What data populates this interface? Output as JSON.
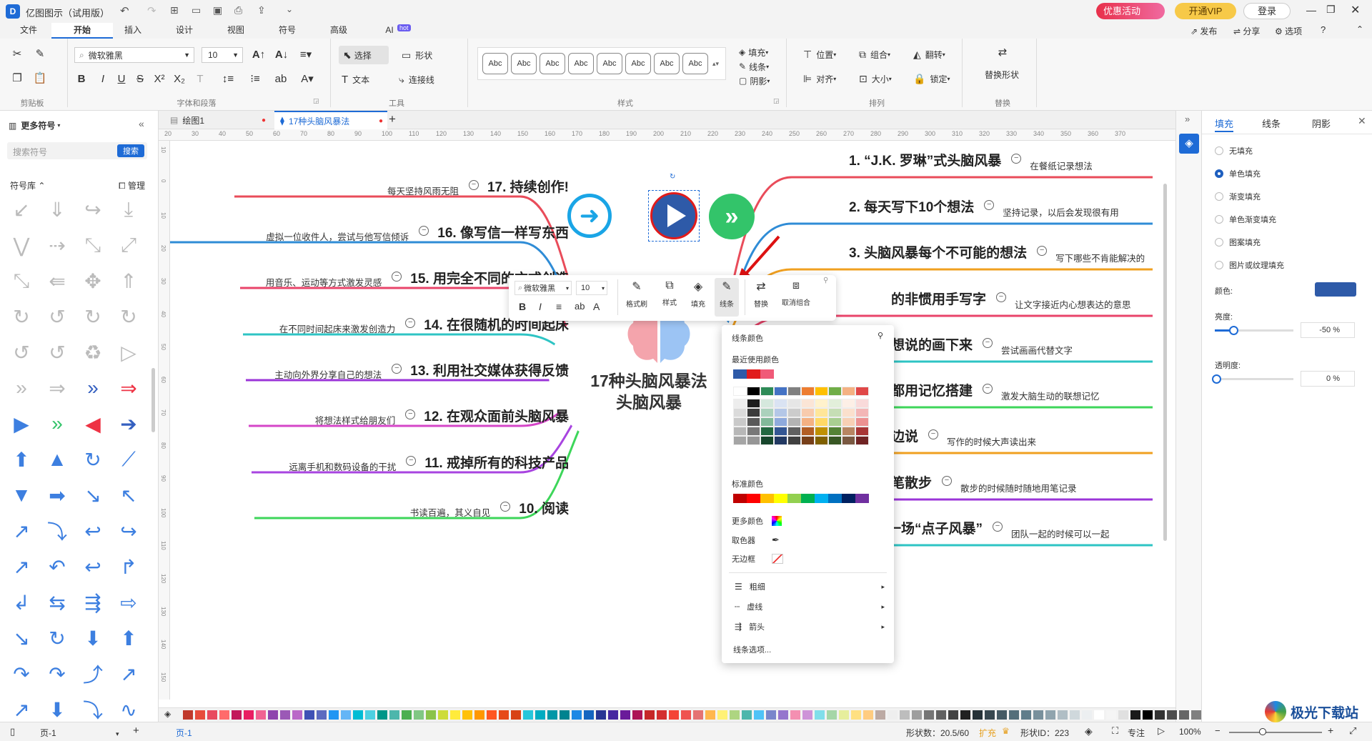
{
  "app": {
    "title": "亿图图示（试用版）",
    "promo": "优惠活动",
    "vip": "开通VIP",
    "login": "登录"
  },
  "menu": {
    "tabs": [
      "文件",
      "开始",
      "插入",
      "设计",
      "视图",
      "符号",
      "高级",
      "AI"
    ],
    "ai_badge": "hot",
    "active": "开始",
    "right": [
      "发布",
      "分享",
      "选项"
    ]
  },
  "ribbon": {
    "font_name": "微软雅黑",
    "font_size": "10",
    "select": "选择",
    "shape": "形状",
    "text": "文本",
    "connector": "连接线",
    "style_sample": "Abc",
    "fill": "填充",
    "line": "线条",
    "shadow": "阴影",
    "position": "位置",
    "group": "组合",
    "flip": "翻转",
    "align": "对齐",
    "size": "大小",
    "lock": "锁定",
    "replace_shape": "替换形状",
    "groups": [
      "剪贴板",
      "字体和段落",
      "工具",
      "样式",
      "排列",
      "替换"
    ]
  },
  "left_panel": {
    "title": "更多符号",
    "search_placeholder": "搜索符号",
    "search_btn": "搜索",
    "lib": "符号库",
    "manage": "管理"
  },
  "doc_tabs": [
    {
      "label": "绘图1"
    },
    {
      "label": "17种头脑风暴法"
    }
  ],
  "ruler_ticks": [
    "20",
    "30",
    "40",
    "50",
    "60",
    "70",
    "80",
    "90",
    "100",
    "110",
    "120",
    "130",
    "140",
    "150",
    "160",
    "170",
    "180",
    "190",
    "200",
    "210",
    "220",
    "230",
    "240",
    "250",
    "260",
    "270",
    "280",
    "290",
    "300",
    "310",
    "320",
    "330",
    "340",
    "350",
    "360",
    "370"
  ],
  "vruler_ticks": [
    "10",
    "0",
    "10",
    "20",
    "30",
    "40",
    "50",
    "60",
    "70",
    "80",
    "90",
    "100",
    "110",
    "120",
    "130",
    "140",
    "150"
  ],
  "mindmap": {
    "center": "17种头脑风暴法\n头脑风暴",
    "left": [
      {
        "title": "17. 持续创作!",
        "note": "每天坚持风雨无阻",
        "color": "#e94c5a"
      },
      {
        "title": "16. 像写信一样写东西",
        "note": "虚拟一位收件人，尝试与他写信倾诉",
        "color": "#2f8cd6"
      },
      {
        "title": "15. 用完全不同的方式创造",
        "note": "用音乐、运动等方式激发灵感",
        "color": "#e9446a"
      },
      {
        "title": "14. 在很随机的时间起床",
        "note": "在不同时间起床来激发创造力",
        "color": "#2ec4c4"
      },
      {
        "title": "13. 利用社交媒体获得反馈",
        "note": "主动向外界分享自己的想法",
        "color": "#9b35d8"
      },
      {
        "title": "12. 在观众面前头脑风暴",
        "note": "将想法样式给朋友们",
        "color": "#d546c8"
      },
      {
        "title": "11. 戒掉所有的科技产品",
        "note": "远离手机和数码设备的干扰",
        "color": "#a844e0"
      },
      {
        "title": "10. 阅读",
        "note": "书读百遍，其义自见",
        "color": "#3dd65a"
      }
    ],
    "right": [
      {
        "title": "1. “J.K. 罗琳”式头脑风暴",
        "note": "在餐纸记录想法",
        "color": "#e94c5a"
      },
      {
        "title": "2. 每天写下10个想法",
        "note": "坚持记录，以后会发现很有用",
        "color": "#2f8cd6"
      },
      {
        "title": "3. 头脑风暴每个不可能的想法",
        "note": "写下哪些不肯能解决的",
        "color": "#f0a020"
      },
      {
        "title": "的非惯用手写字",
        "note": "让文字接近内心想表达的意思",
        "color": "#e9446a"
      },
      {
        "title": "想说的画下来",
        "note": "尝试画画代替文字",
        "color": "#2ec4c4"
      },
      {
        "title": "都用记忆搭建",
        "note": "激发大脑生动的联想记忆",
        "color": "#3dd65a"
      },
      {
        "title": "边说",
        "note": "写作的时候大声读出来",
        "color": "#f0a020"
      },
      {
        "title": "笔散步",
        "note": "散步的时候随时随地用笔记录",
        "color": "#9b35d8"
      },
      {
        "title": "一场“点子风暴”",
        "note": "团队一起的时候可以一起",
        "color": "#2ec4c4"
      }
    ]
  },
  "float_toolbar": {
    "font": "微软雅黑",
    "size": "10",
    "buttons": [
      "格式刷",
      "样式",
      "填充",
      "线条",
      "替换",
      "取消组合"
    ]
  },
  "line_color_menu": {
    "title": "线条颜色",
    "recent": "最近使用颜色",
    "standard": "标准颜色",
    "more": "更多颜色",
    "picker": "取色器",
    "none": "无边框",
    "items": [
      "粗细",
      "虚线",
      "箭头"
    ],
    "options": "线条选项...",
    "recent_colors": [
      "#2e5aa8",
      "#e11b1b",
      "#f05a78"
    ],
    "standard_colors": [
      "#c00000",
      "#ff0000",
      "#ffc000",
      "#ffff00",
      "#92d050",
      "#00b050",
      "#00b0f0",
      "#0070c0",
      "#002060",
      "#7030a0"
    ]
  },
  "right_panel": {
    "tabs": [
      "填充",
      "线条",
      "阴影"
    ],
    "fill_options": [
      "无填充",
      "单色填充",
      "渐变填充",
      "单色渐变填充",
      "图案填充",
      "图片或纹理填充"
    ],
    "selected": "单色填充",
    "color_label": "颜色:",
    "color": "#2e5aa8",
    "brightness_label": "亮度:",
    "brightness": "-50 %",
    "transparency_label": "透明度:",
    "transparency": "0 %"
  },
  "status": {
    "page": "页-1",
    "page_tab": "页-1",
    "shapes": "形状数：20.5/60",
    "expand": "扩充",
    "shape_id": "形状ID：223",
    "focus": "专注",
    "zoom": "100%"
  },
  "watermark": "极光下载站"
}
